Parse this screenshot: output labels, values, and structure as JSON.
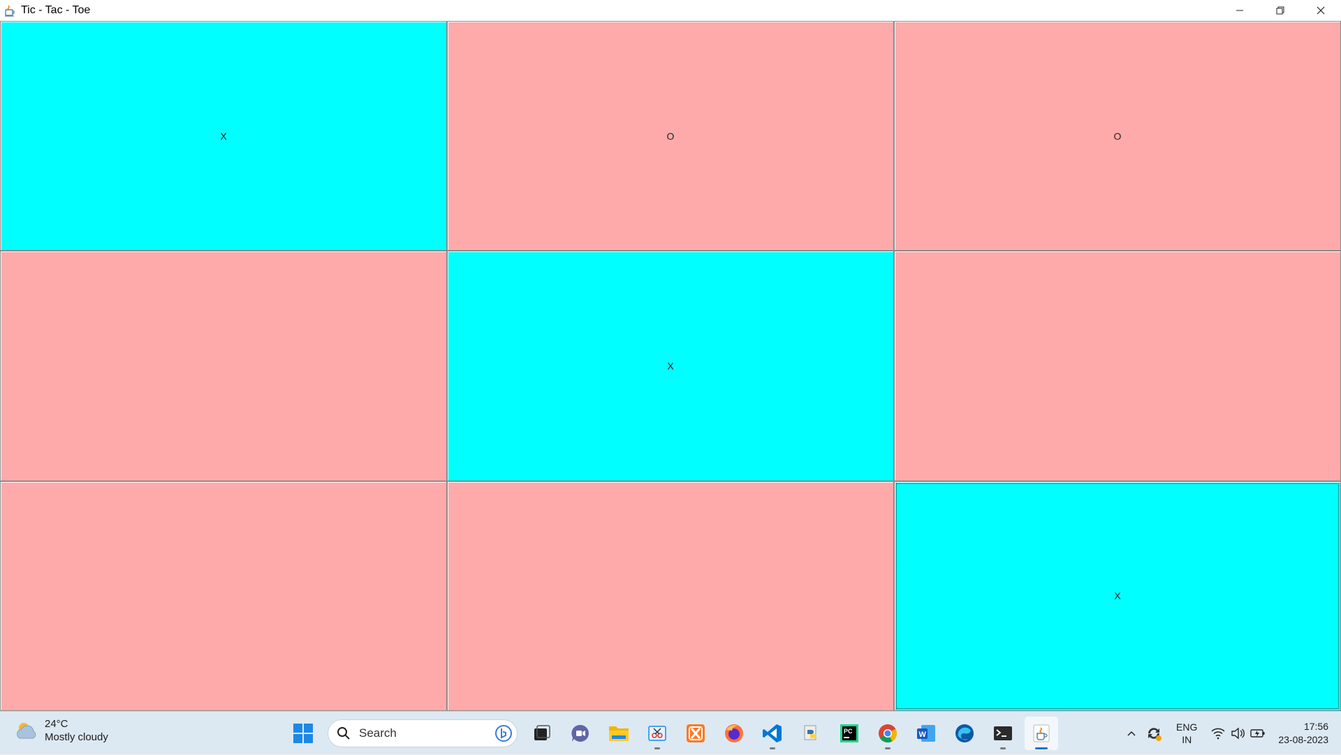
{
  "window": {
    "title": "Tic - Tac - Toe",
    "icon": "java-icon"
  },
  "board": {
    "colors": {
      "x_cell": "#00ffff",
      "empty_cell": "#ffaaaa",
      "o_cell": "#ffaaaa"
    },
    "cells": [
      {
        "mark": "X",
        "color": "#00ffff"
      },
      {
        "mark": "O",
        "color": "#ffaaaa"
      },
      {
        "mark": "O",
        "color": "#ffaaaa"
      },
      {
        "mark": "",
        "color": "#ffaaaa"
      },
      {
        "mark": "X",
        "color": "#00ffff"
      },
      {
        "mark": "",
        "color": "#ffaaaa"
      },
      {
        "mark": "",
        "color": "#ffaaaa"
      },
      {
        "mark": "",
        "color": "#ffaaaa"
      },
      {
        "mark": "X",
        "color": "#00ffff"
      }
    ]
  },
  "taskbar": {
    "weather": {
      "temperature": "24°C",
      "condition": "Mostly cloudy"
    },
    "search": {
      "label": "Search"
    },
    "pinned": [
      "start",
      "search",
      "task-view",
      "teams",
      "file-explorer",
      "snipping-tool",
      "xampp",
      "firefox",
      "vscode",
      "python",
      "pycharm",
      "chrome",
      "word",
      "edge",
      "terminal",
      "java"
    ],
    "tray": {
      "language": "ENG",
      "region": "IN",
      "time": "17:56",
      "date": "23-08-2023"
    }
  }
}
